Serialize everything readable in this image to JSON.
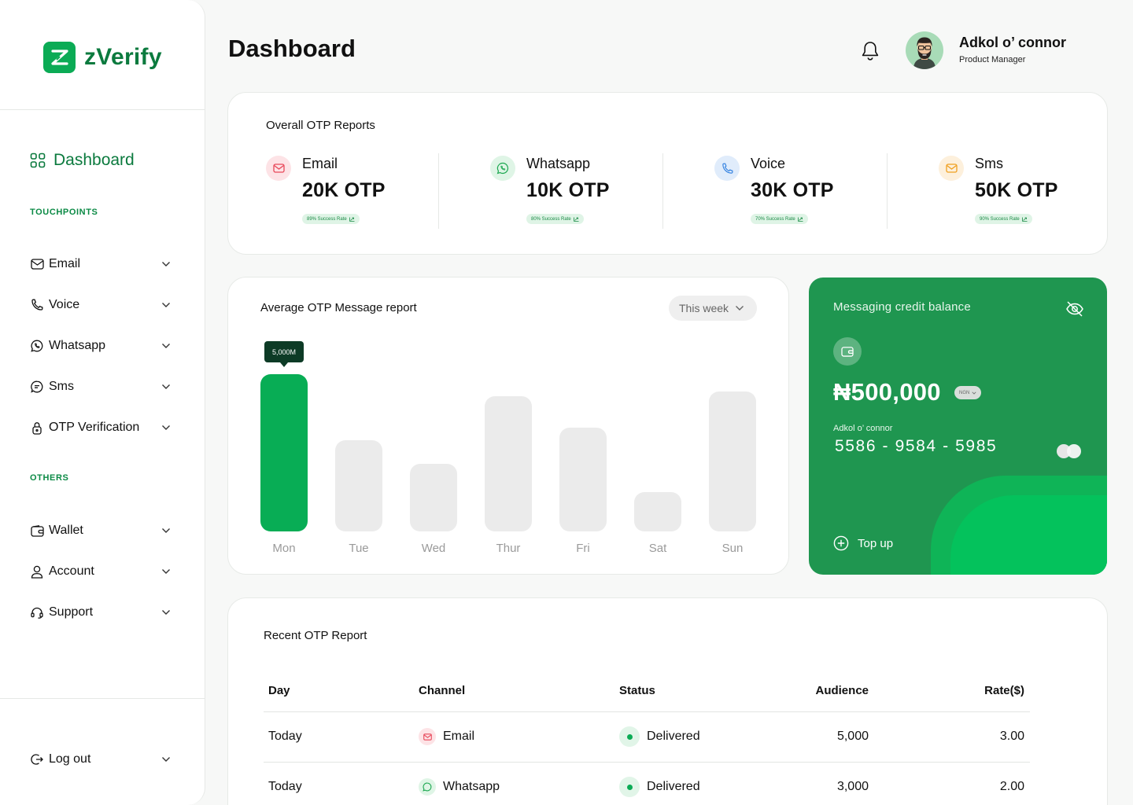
{
  "app": {
    "name": "zVerify"
  },
  "sidebar": {
    "dashboard_label": "Dashboard",
    "touchpoints_heading": "TOUCHPOINTS",
    "others_heading": "OTHERS",
    "touchpoints": [
      {
        "label": "Email",
        "icon": "mail-icon"
      },
      {
        "label": "Voice",
        "icon": "phone-icon"
      },
      {
        "label": "Whatsapp",
        "icon": "whatsapp-icon"
      },
      {
        "label": "Sms",
        "icon": "chat-icon"
      },
      {
        "label": "OTP Verification",
        "icon": "lock-icon"
      }
    ],
    "others": [
      {
        "label": "Wallet",
        "icon": "wallet-icon"
      },
      {
        "label": "Account",
        "icon": "user-icon"
      },
      {
        "label": "Support",
        "icon": "headset-icon"
      }
    ],
    "logout_label": "Log out"
  },
  "header": {
    "title": "Dashboard",
    "user_name": "Adkol o’ connor",
    "user_role": "Product Manager"
  },
  "otp_reports": {
    "title": "Overall OTP Reports",
    "items": [
      {
        "name": "Email",
        "value": "20K OTP",
        "rate": "89% Success Rate",
        "icon": "mail-icon",
        "color": "#e8485a",
        "bg": "#fde3e6"
      },
      {
        "name": "Whatsapp",
        "value": "10K OTP",
        "rate": "80% Success Rate",
        "icon": "whatsapp-icon",
        "color": "#1da851",
        "bg": "#dff5e6"
      },
      {
        "name": "Voice",
        "value": "30K OTP",
        "rate": "70% Success Rate",
        "icon": "phone-icon",
        "color": "#2f7fe0",
        "bg": "#e0ecfb"
      },
      {
        "name": "Sms",
        "value": "50K OTP",
        "rate": "90% Success Rate",
        "icon": "chat-icon",
        "color": "#f0a020",
        "bg": "#fdf0dc"
      }
    ]
  },
  "chart_data": {
    "type": "bar",
    "title": "Average OTP Message report",
    "period_select": "This week",
    "categories": [
      "Mon",
      "Tue",
      "Wed",
      "Thur",
      "Fri",
      "Sat",
      "Sun"
    ],
    "values": [
      5000,
      2900,
      2150,
      4300,
      3300,
      1250,
      4450
    ],
    "highlight_index": 0,
    "tooltip": "5,000M",
    "colors": {
      "highlight": "#08ad55",
      "default": "#ebebeb"
    }
  },
  "wallet": {
    "title": "Messaging credit balance",
    "amount": "₦500,000",
    "currency": "NGN",
    "holder": "Adkol o’ connor",
    "number": "5586 - 9584 - 5985",
    "topup_label": "Top up"
  },
  "recent": {
    "title": "Recent  OTP Report",
    "columns": [
      "Day",
      "Channel",
      "Status",
      "Audience",
      "Rate($)"
    ],
    "rows": [
      {
        "day": "Today",
        "channel": "Email",
        "channel_icon": "mail-icon",
        "status": "Delivered",
        "audience": "5,000",
        "rate": "3.00"
      },
      {
        "day": "Today",
        "channel": "Whatsapp",
        "channel_icon": "whatsapp-icon",
        "status": "Delivered",
        "audience": "3,000",
        "rate": "2.00"
      }
    ]
  }
}
